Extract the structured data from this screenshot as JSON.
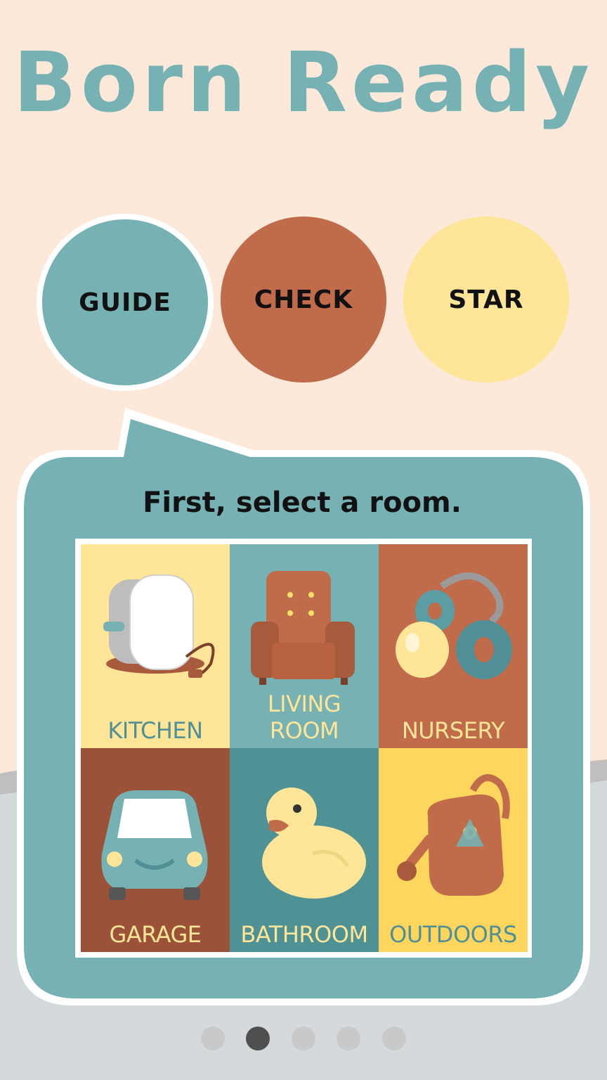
{
  "app": {
    "title": "Born Ready"
  },
  "colors": {
    "background": "#fde9d9",
    "teal": "#76b1b3",
    "rust": "#c06b4a",
    "cream": "#fee597"
  },
  "nav": {
    "guide_label": "GUIDE",
    "check_label": "CHECK",
    "star_label": "STAR",
    "active": "guide"
  },
  "panel": {
    "prompt": "First, select a room."
  },
  "rooms": [
    {
      "label": "KITCHEN",
      "icon": "toaster-icon"
    },
    {
      "label": "LIVING ROOM",
      "icon": "armchair-icon"
    },
    {
      "label": "NURSERY",
      "icon": "pacifier-icon"
    },
    {
      "label": "GARAGE",
      "icon": "car-icon"
    },
    {
      "label": "BATHROOM",
      "icon": "rubber-duck-icon"
    },
    {
      "label": "OUTDOORS",
      "icon": "watering-can-icon"
    }
  ],
  "pager": {
    "count": 5,
    "active_index": 2
  }
}
